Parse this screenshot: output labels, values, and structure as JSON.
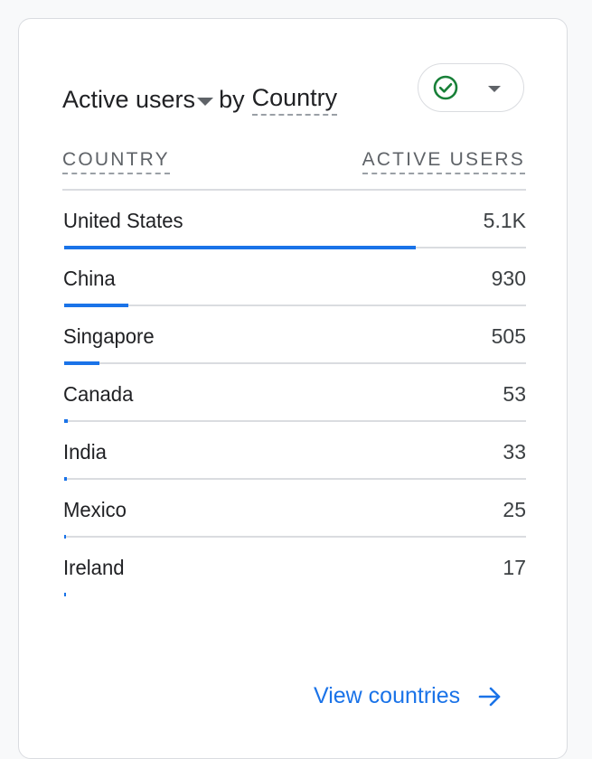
{
  "card": {
    "metric": "Active users",
    "by": "by",
    "dimension": "Country"
  },
  "status": {
    "icon": "check-circle-icon",
    "icon_color": "#188038"
  },
  "table": {
    "headers": {
      "country": "COUNTRY",
      "active_users": "ACTIVE USERS"
    },
    "rows": [
      {
        "country": "United States",
        "value": "5.1K",
        "bar_fraction": 0.762
      },
      {
        "country": "China",
        "value": "930",
        "bar_fraction": 0.139
      },
      {
        "country": "Singapore",
        "value": "505",
        "bar_fraction": 0.076
      },
      {
        "country": "Canada",
        "value": "53",
        "bar_fraction": 0.008
      },
      {
        "country": "India",
        "value": "33",
        "bar_fraction": 0.005
      },
      {
        "country": "Mexico",
        "value": "25",
        "bar_fraction": 0.004
      },
      {
        "country": "Ireland",
        "value": "17",
        "bar_fraction": 0.003
      }
    ]
  },
  "footer": {
    "link_label": "View countries",
    "link_icon": "arrow-right-icon"
  },
  "colors": {
    "accent": "#1a73e8",
    "success": "#188038"
  }
}
